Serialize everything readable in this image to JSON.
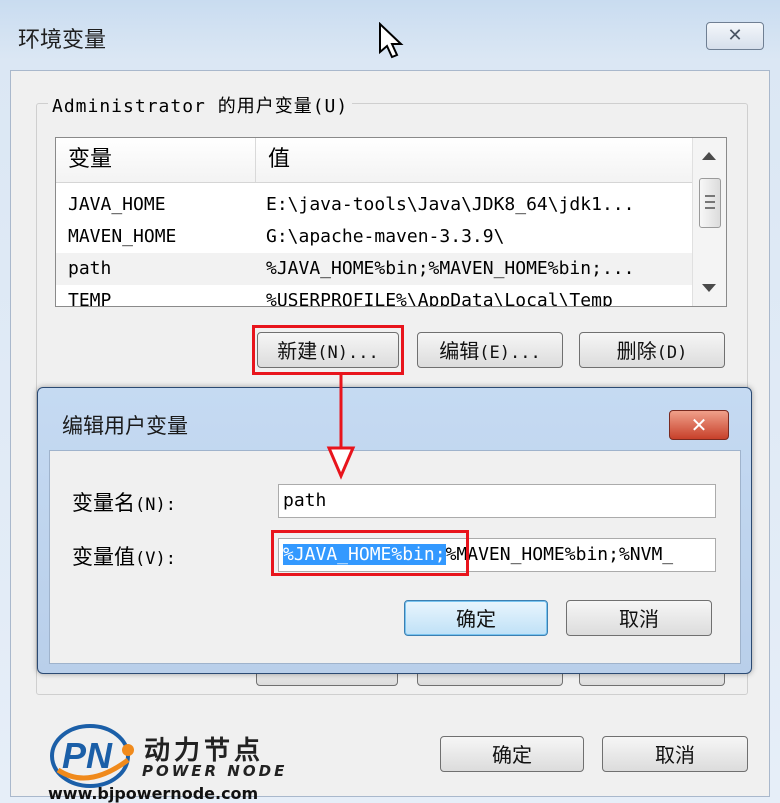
{
  "window": {
    "title": "环境变量",
    "close_glyph": "✕"
  },
  "user_vars": {
    "group_title": "Administrator 的用户变量(U)",
    "columns": [
      "变量",
      "值"
    ],
    "rows": [
      {
        "name": "JAVA_HOME",
        "value": "E:\\java-tools\\Java\\JDK8_64\\jdk1..."
      },
      {
        "name": "MAVEN_HOME",
        "value": "G:\\apache-maven-3.3.9\\"
      },
      {
        "name": "path",
        "value": "%JAVA_HOME%bin;%MAVEN_HOME%bin;..."
      },
      {
        "name": "TEMP",
        "value": "%USERPROFILE%\\AppData\\Local\\Temp"
      }
    ],
    "buttons": {
      "new_label": "新建",
      "new_accel": "(N)...",
      "edit_label": "编辑",
      "edit_accel": "(E)...",
      "delete_label": "删除",
      "delete_accel": "(D)"
    }
  },
  "edit_dialog": {
    "title": "编辑用户变量",
    "close_glyph": "✕",
    "name_label": "变量名",
    "name_accel": "(N):",
    "name_value": "path",
    "value_label": "变量值",
    "value_accel": "(V):",
    "value_selected": "%JAVA_HOME%bin;",
    "value_rest": "%MAVEN_HOME%bin;%NVM_",
    "ok_label": "确定",
    "cancel_label": "取消"
  },
  "footer": {
    "ok_label": "确定",
    "cancel_label": "取消"
  },
  "logo": {
    "chinese": "动力节点",
    "english": "POWER NODE",
    "url": "www.bjpowernode.com",
    "mark_text": "PN"
  },
  "colors": {
    "annotation_red": "#e8141c",
    "selection_blue": "#3399ff"
  }
}
